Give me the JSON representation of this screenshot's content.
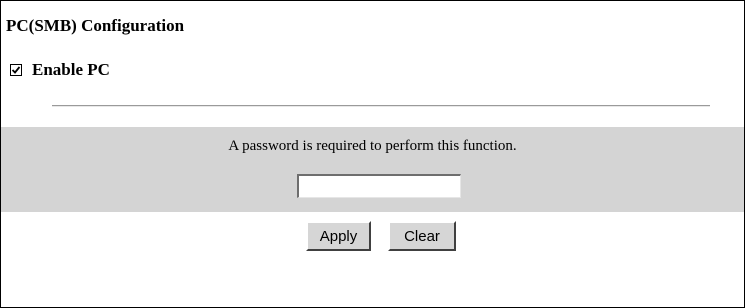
{
  "page": {
    "title": "PC(SMB) Configuration"
  },
  "enable_pc": {
    "label": "Enable PC",
    "checked": true
  },
  "password_section": {
    "message": "A password is required to perform this function.",
    "input_value": "",
    "input_placeholder": ""
  },
  "buttons": {
    "apply_label": "Apply",
    "clear_label": "Clear"
  },
  "colors": {
    "panel_background": "#d4d4d4",
    "divider": "#9a9a9a",
    "button_face": "#d6d6d6"
  }
}
